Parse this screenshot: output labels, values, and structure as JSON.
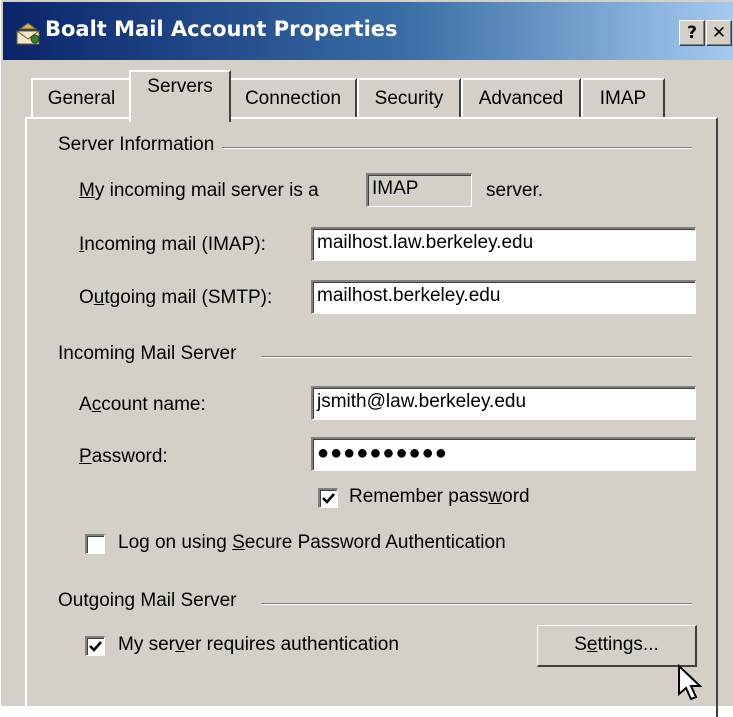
{
  "window": {
    "title": "Boalt Mail Account Properties",
    "help_label": "?",
    "close_label": "✕"
  },
  "tabs": [
    {
      "label": "General"
    },
    {
      "label": "Servers",
      "active": true
    },
    {
      "label": "Connection"
    },
    {
      "label": "Security"
    },
    {
      "label": "Advanced"
    },
    {
      "label": "IMAP"
    }
  ],
  "server_info": {
    "group_label": "Server Information",
    "incoming_type_prefix_u": "M",
    "incoming_type_prefix_rest": "y incoming mail server is a",
    "incoming_type_value": "IMAP",
    "incoming_type_suffix": "server.",
    "incoming_label_u": "I",
    "incoming_label_rest": "ncoming mail (IMAP):",
    "incoming_value": "mailhost.law.berkeley.edu",
    "outgoing_label_a": "O",
    "outgoing_label_u": "u",
    "outgoing_label_rest": "tgoing mail (SMTP):",
    "outgoing_value": "mailhost.berkeley.edu"
  },
  "incoming_server": {
    "group_label": "Incoming Mail Server",
    "account_label_a": "A",
    "account_label_u": "c",
    "account_label_rest": "count name:",
    "account_value": "jsmith@law.berkeley.edu",
    "password_label_u": "P",
    "password_label_rest": "assword:",
    "password_value": "●●●●●●●●●●",
    "remember_label_a": "Remember pass",
    "remember_label_u": "w",
    "remember_label_rest": "ord",
    "remember_checked": true,
    "spa_label_a": "Log on using ",
    "spa_label_u": "S",
    "spa_label_rest": "ecure Password Authentication",
    "spa_checked": false
  },
  "outgoing_server": {
    "group_label": "Outgoing Mail Server",
    "auth_label_a": "My ser",
    "auth_label_u": "v",
    "auth_label_rest": "er requires authentication",
    "auth_checked": true,
    "settings_a": "S",
    "settings_u": "e",
    "settings_rest": "ttings..."
  }
}
